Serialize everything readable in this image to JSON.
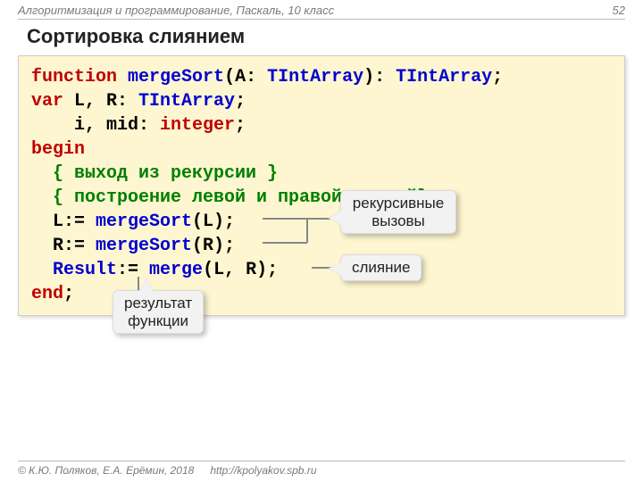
{
  "header": {
    "course": "Алгоритмизация и программирование, Паскаль, 10 класс",
    "page": "52"
  },
  "title": "Сортировка слиянием",
  "code": {
    "l1": {
      "function": "function",
      "name": "mergeSort",
      "sig1": "(A: ",
      "type1": "TIntArray",
      "sig2": "): ",
      "type2": "TIntArray",
      "semi": ";"
    },
    "l2": {
      "var": "var",
      "rest": " L, R: ",
      "type": "TIntArray",
      "semi": ";"
    },
    "l3": {
      "indent": "    i, mid: ",
      "type": "integer",
      "semi": ";"
    },
    "l4": {
      "begin": "begin"
    },
    "l5": {
      "comment": "  { выход из рекурсии }"
    },
    "l6": {
      "comment": "  { построение левой и правой частей}"
    },
    "l7": {
      "pre": "  L:= ",
      "call": "mergeSort",
      "post": "(L);"
    },
    "l8": {
      "pre": "  R:= ",
      "call": "mergeSort",
      "post": "(R);"
    },
    "l9": {
      "pre": "  ",
      "res": "Result",
      "mid": ":= ",
      "call": "merge",
      "post": "(L, R);"
    },
    "l10": {
      "end": "end",
      "semi": ";"
    }
  },
  "callouts": {
    "recursive1": "рекурсивные",
    "recursive2": "вызовы",
    "merge": "слияние",
    "result1": "результат",
    "result2": "функции"
  },
  "footer": {
    "copy": "© К.Ю. Поляков, Е.А. Ерёмин, 2018",
    "url": "http://kpolyakov.spb.ru"
  }
}
